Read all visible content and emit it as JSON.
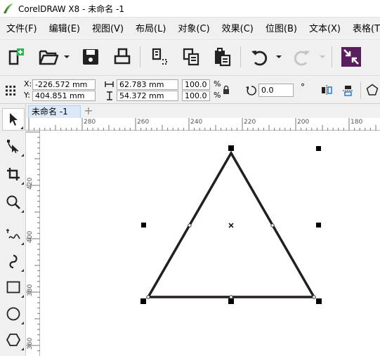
{
  "window": {
    "title": "CorelDRAW X8 - 未命名 -1"
  },
  "menu": [
    {
      "label": "文件(F)"
    },
    {
      "label": "编辑(E)"
    },
    {
      "label": "视图(V)"
    },
    {
      "label": "布局(L)"
    },
    {
      "label": "对象(C)"
    },
    {
      "label": "效果(C)"
    },
    {
      "label": "位图(B)"
    },
    {
      "label": "文本(X)"
    },
    {
      "label": "表格(T)"
    }
  ],
  "toolbar": {
    "icons": [
      "new-document-icon",
      "open-folder-icon",
      "save-icon",
      "print-icon",
      "copy-icon",
      "copy-pages-icon",
      "paste-icon",
      "undo-icon",
      "redo-icon",
      "import-icon"
    ]
  },
  "propbar": {
    "x_label": "X:",
    "x_value": "-226.572 mm",
    "y_label": "Y:",
    "y_value": "404.851 mm",
    "width_value": "62.783 mm",
    "height_value": "54.372 mm",
    "scale_x": "100.0",
    "scale_y": "100.0",
    "percent": "%",
    "rotation_value": "0.0",
    "degree_symbol": "°"
  },
  "document": {
    "tab_label": "未命名 -1",
    "new_tab": "+"
  },
  "rulers": {
    "horizontal": [
      "280",
      "260",
      "240",
      "220",
      "200",
      "180"
    ],
    "vertical": [
      "420",
      "400",
      "380",
      "360"
    ]
  },
  "tools": [
    "pick-tool",
    "shape-tool",
    "crop-tool",
    "zoom-tool",
    "freehand-tool",
    "artistic-media-tool",
    "rectangle-tool",
    "ellipse-tool",
    "polygon-tool"
  ],
  "colors": {
    "menu_bg": "#f0f0f0",
    "active_tab": "#dbe9f8",
    "shape_stroke": "#231f20",
    "logo_green": "#6cb33f"
  }
}
